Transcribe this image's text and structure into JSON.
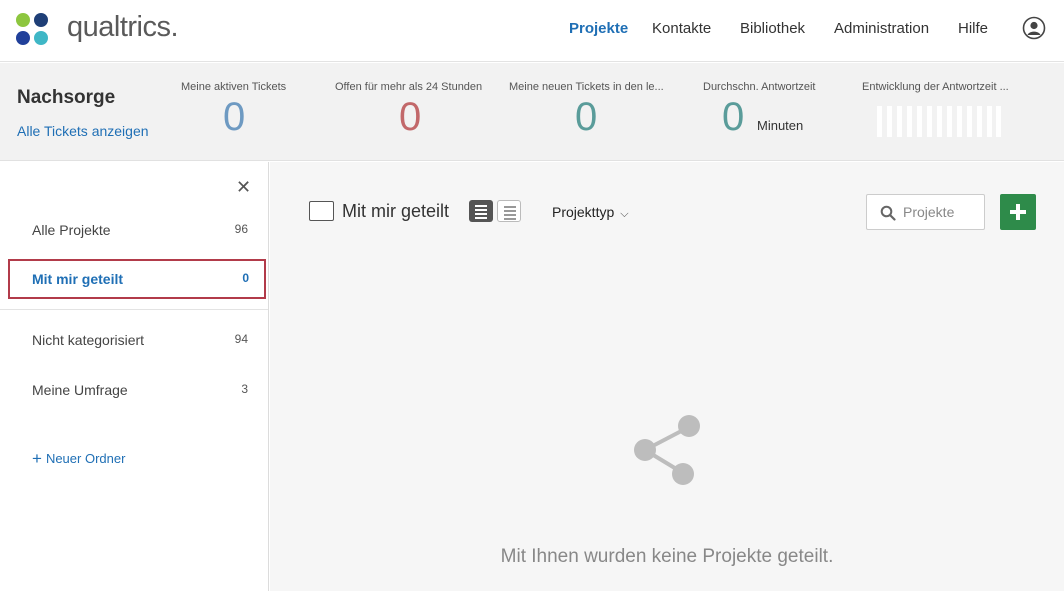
{
  "brand": {
    "name": "qualtrics."
  },
  "nav": [
    {
      "label": "Projekte",
      "active": true
    },
    {
      "label": "Kontakte"
    },
    {
      "label": "Bibliothek"
    },
    {
      "label": "Administration"
    },
    {
      "label": "Hilfe"
    }
  ],
  "dashboard": {
    "title": "Nachsorge",
    "link": "Alle Tickets anzeigen",
    "stats": [
      {
        "label": "Meine aktiven Tickets",
        "value": "0",
        "color": "#6e9ac2"
      },
      {
        "label": "Offen für mehr als 24 Stunden",
        "value": "0",
        "color": "#c2686a"
      },
      {
        "label": "Meine neuen Tickets in den le...",
        "value": "0",
        "color": "#5a9c9a"
      },
      {
        "label": "Durchschn. Antwortzeit",
        "value": "0",
        "unit": "Minuten",
        "color": "#5a9c9a"
      },
      {
        "label": "Entwicklung der Antwortzeit ..."
      }
    ]
  },
  "sidebar": {
    "items": [
      {
        "label": "Alle Projekte",
        "count": "96"
      },
      {
        "label": "Mit mir geteilt",
        "count": "0",
        "selected": true
      },
      {
        "label": "Nicht kategorisiert",
        "count": "94"
      },
      {
        "label": "Meine Umfrage",
        "count": "3"
      }
    ],
    "new_folder": "Neuer Ordner"
  },
  "main": {
    "title": "Mit mir geteilt",
    "filter": "Projekttyp",
    "search_placeholder": "Projekte",
    "empty_message": "Mit Ihnen wurden keine Projekte geteilt."
  }
}
